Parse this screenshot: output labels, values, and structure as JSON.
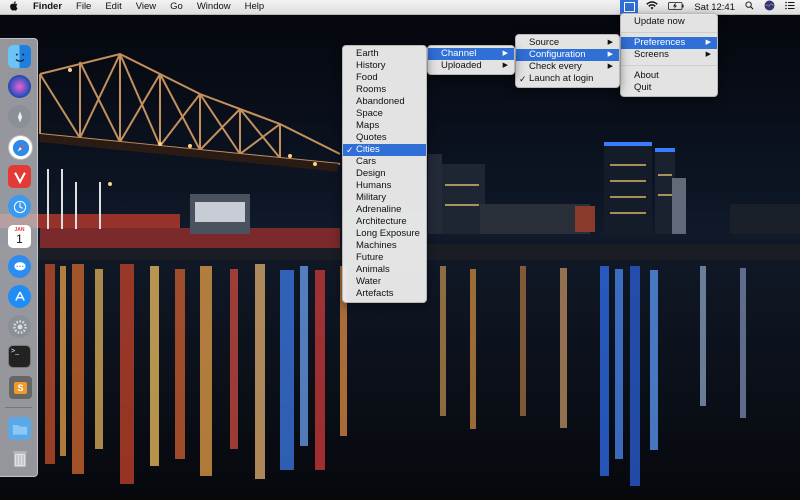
{
  "menubar": {
    "app_name": "Finder",
    "menus": [
      "File",
      "Edit",
      "View",
      "Go",
      "Window",
      "Help"
    ],
    "clock": "Sat 12:41"
  },
  "main_menu": {
    "items": [
      {
        "label": "Update now"
      },
      {
        "label": "Preferences"
      },
      {
        "label": "Screens"
      },
      {
        "label": "About"
      },
      {
        "label": "Quit"
      }
    ]
  },
  "preferences_menu": {
    "items": [
      {
        "label": "Source"
      },
      {
        "label": "Configuration"
      },
      {
        "label": "Check every"
      },
      {
        "label": "Launch at login",
        "checked": true
      }
    ]
  },
  "configuration_menu": {
    "items": [
      {
        "label": "Channel"
      },
      {
        "label": "Uploaded"
      }
    ]
  },
  "channel_menu": {
    "items": [
      "Earth",
      "History",
      "Food",
      "Rooms",
      "Abandoned",
      "Space",
      "Maps",
      "Quotes",
      "Cities",
      "Cars",
      "Design",
      "Humans",
      "Military",
      "Adrenaline",
      "Architecture",
      "Long Exposure",
      "Machines",
      "Future",
      "Animals",
      "Water",
      "Artefacts"
    ],
    "selected": "Cities"
  },
  "colors": {
    "highlight": "#2f6fd6",
    "menu_bg": "#ececec"
  },
  "dock": {
    "icons": [
      "finder-icon",
      "siri-icon",
      "launchpad-icon",
      "safari-icon",
      "vivaldi-icon",
      "mail-icon",
      "calendar-icon",
      "messages-icon",
      "app-store-icon",
      "system-preferences-icon",
      "terminal-icon",
      "sublime-text-icon",
      "downloads-folder-icon",
      "trash-icon"
    ],
    "calendar_day": "1",
    "calendar_month": "JAN",
    "sublime_letter": "S",
    "terminal_prompt": ">_"
  }
}
